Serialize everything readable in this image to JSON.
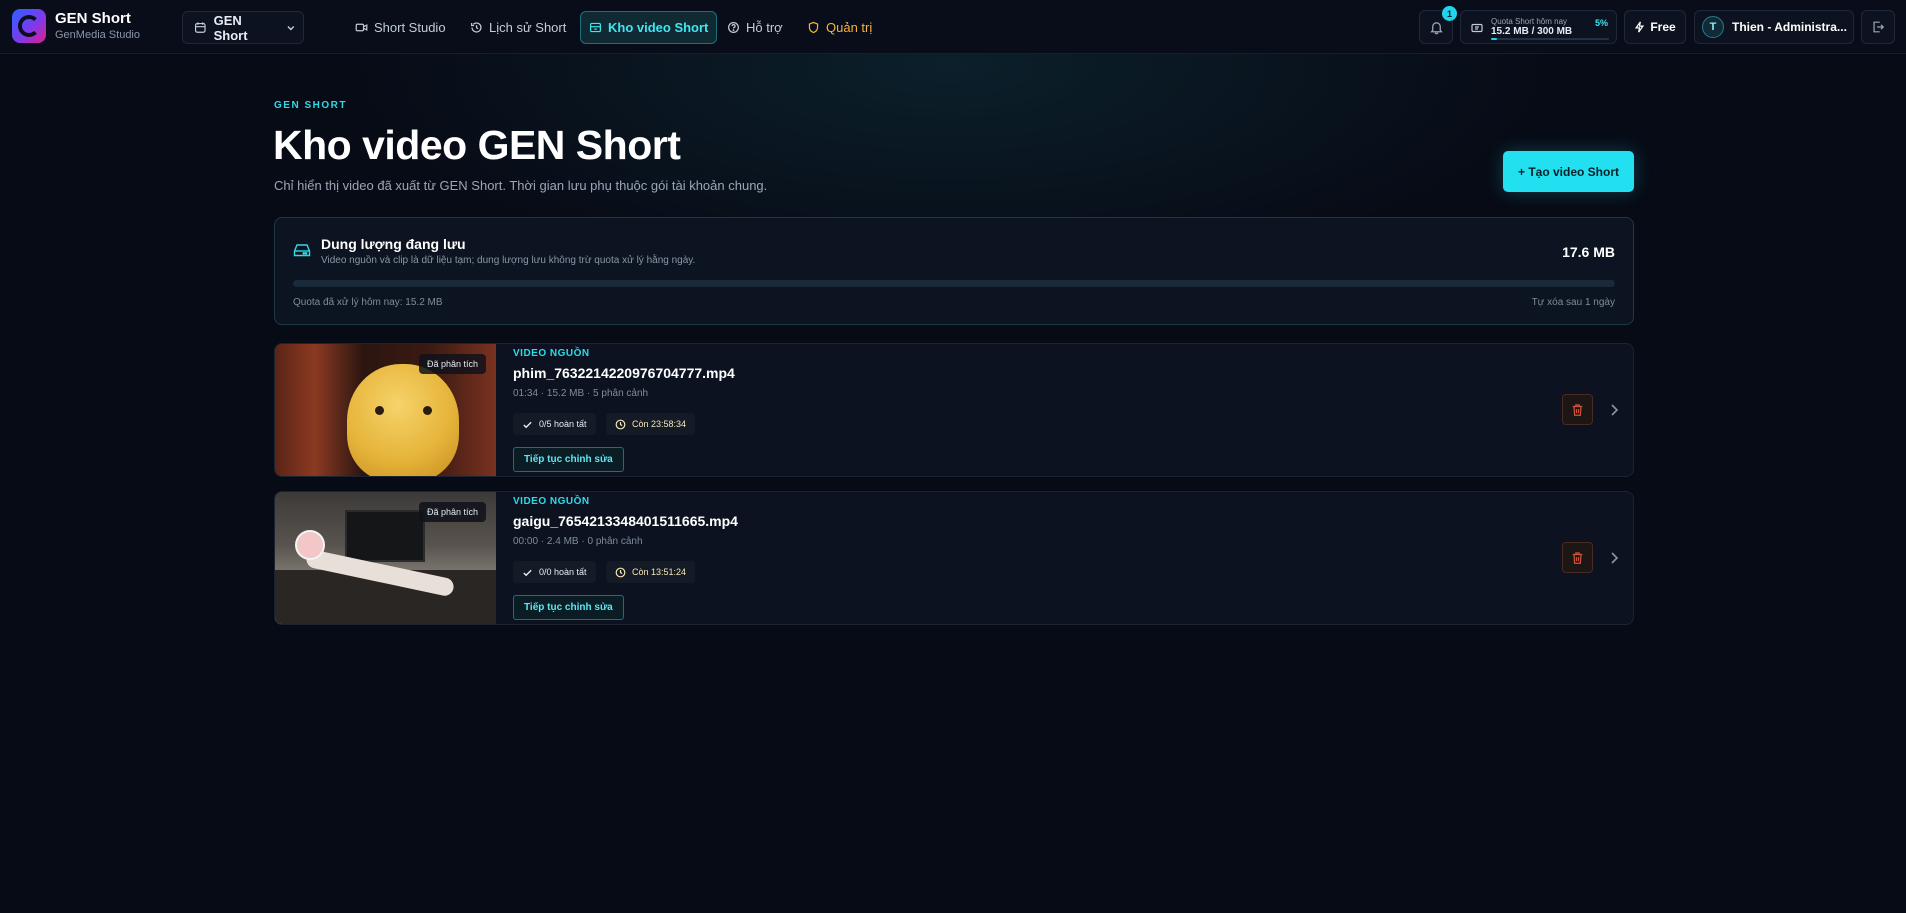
{
  "brand": {
    "name": "GEN Short",
    "subtitle": "GenMedia Studio"
  },
  "workspace": {
    "label": "GEN Short",
    "icon": "calendar-icon"
  },
  "nav": [
    {
      "label": "Short Studio",
      "icon": "video-icon"
    },
    {
      "label": "Lịch sử Short",
      "icon": "history-icon"
    },
    {
      "label": "Kho video Short",
      "icon": "archive-icon",
      "active": true
    },
    {
      "label": "Hỗ trợ",
      "icon": "help-icon"
    },
    {
      "label": "Quản trị",
      "icon": "shield-icon"
    }
  ],
  "notifications": {
    "count": "1"
  },
  "quota": {
    "label": "Quota Short hôm nay",
    "value": "15.2 MB / 300 MB",
    "percent_label": "5%",
    "fraction": 0.05
  },
  "plan": {
    "label": "Free"
  },
  "user": {
    "initial": "T",
    "name": "Thien - Administra..."
  },
  "page": {
    "eyebrow": "GEN SHORT",
    "title": "Kho video GEN Short",
    "description": "Chỉ hiển thị video đã xuất từ GEN Short. Thời gian lưu phụ thuộc gói tài khoản chung.",
    "create_button": "+ Tạo video Short"
  },
  "storage": {
    "title": "Dung lượng đang lưu",
    "subtitle": "Video nguồn và clip là dữ liệu tạm; dung lượng lưu không trừ quota xử lý hằng ngày.",
    "size": "17.6 MB",
    "fill_fraction": 0.0,
    "quota_note": "Quota đã xử lý hôm nay: 15.2 MB",
    "auto_delete": "Tự xóa sau 1 ngày"
  },
  "videos": [
    {
      "badge": "Đã phân tích",
      "kind": "VIDEO NGUỒN",
      "filename": "phim_7632214220976704777.mp4",
      "meta": "01:34 · 15.2 MB · 5 phân cảnh",
      "progress": "0/5 hoàn tất",
      "remaining": "Còn 23:58:34",
      "continue_label": "Tiếp tục chỉnh sửa"
    },
    {
      "badge": "Đã phân tích",
      "kind": "VIDEO NGUỒN",
      "filename": "gaigu_7654213348401511665.mp4",
      "meta": "00:00 · 2.4 MB · 0 phân cảnh",
      "progress": "0/0 hoàn tất",
      "remaining": "Còn 13:51:24",
      "continue_label": "Tiếp tục chỉnh sửa"
    }
  ],
  "colors": {
    "accent": "#22d3ee",
    "background": "#070b16",
    "admin": "#f5b43a"
  }
}
